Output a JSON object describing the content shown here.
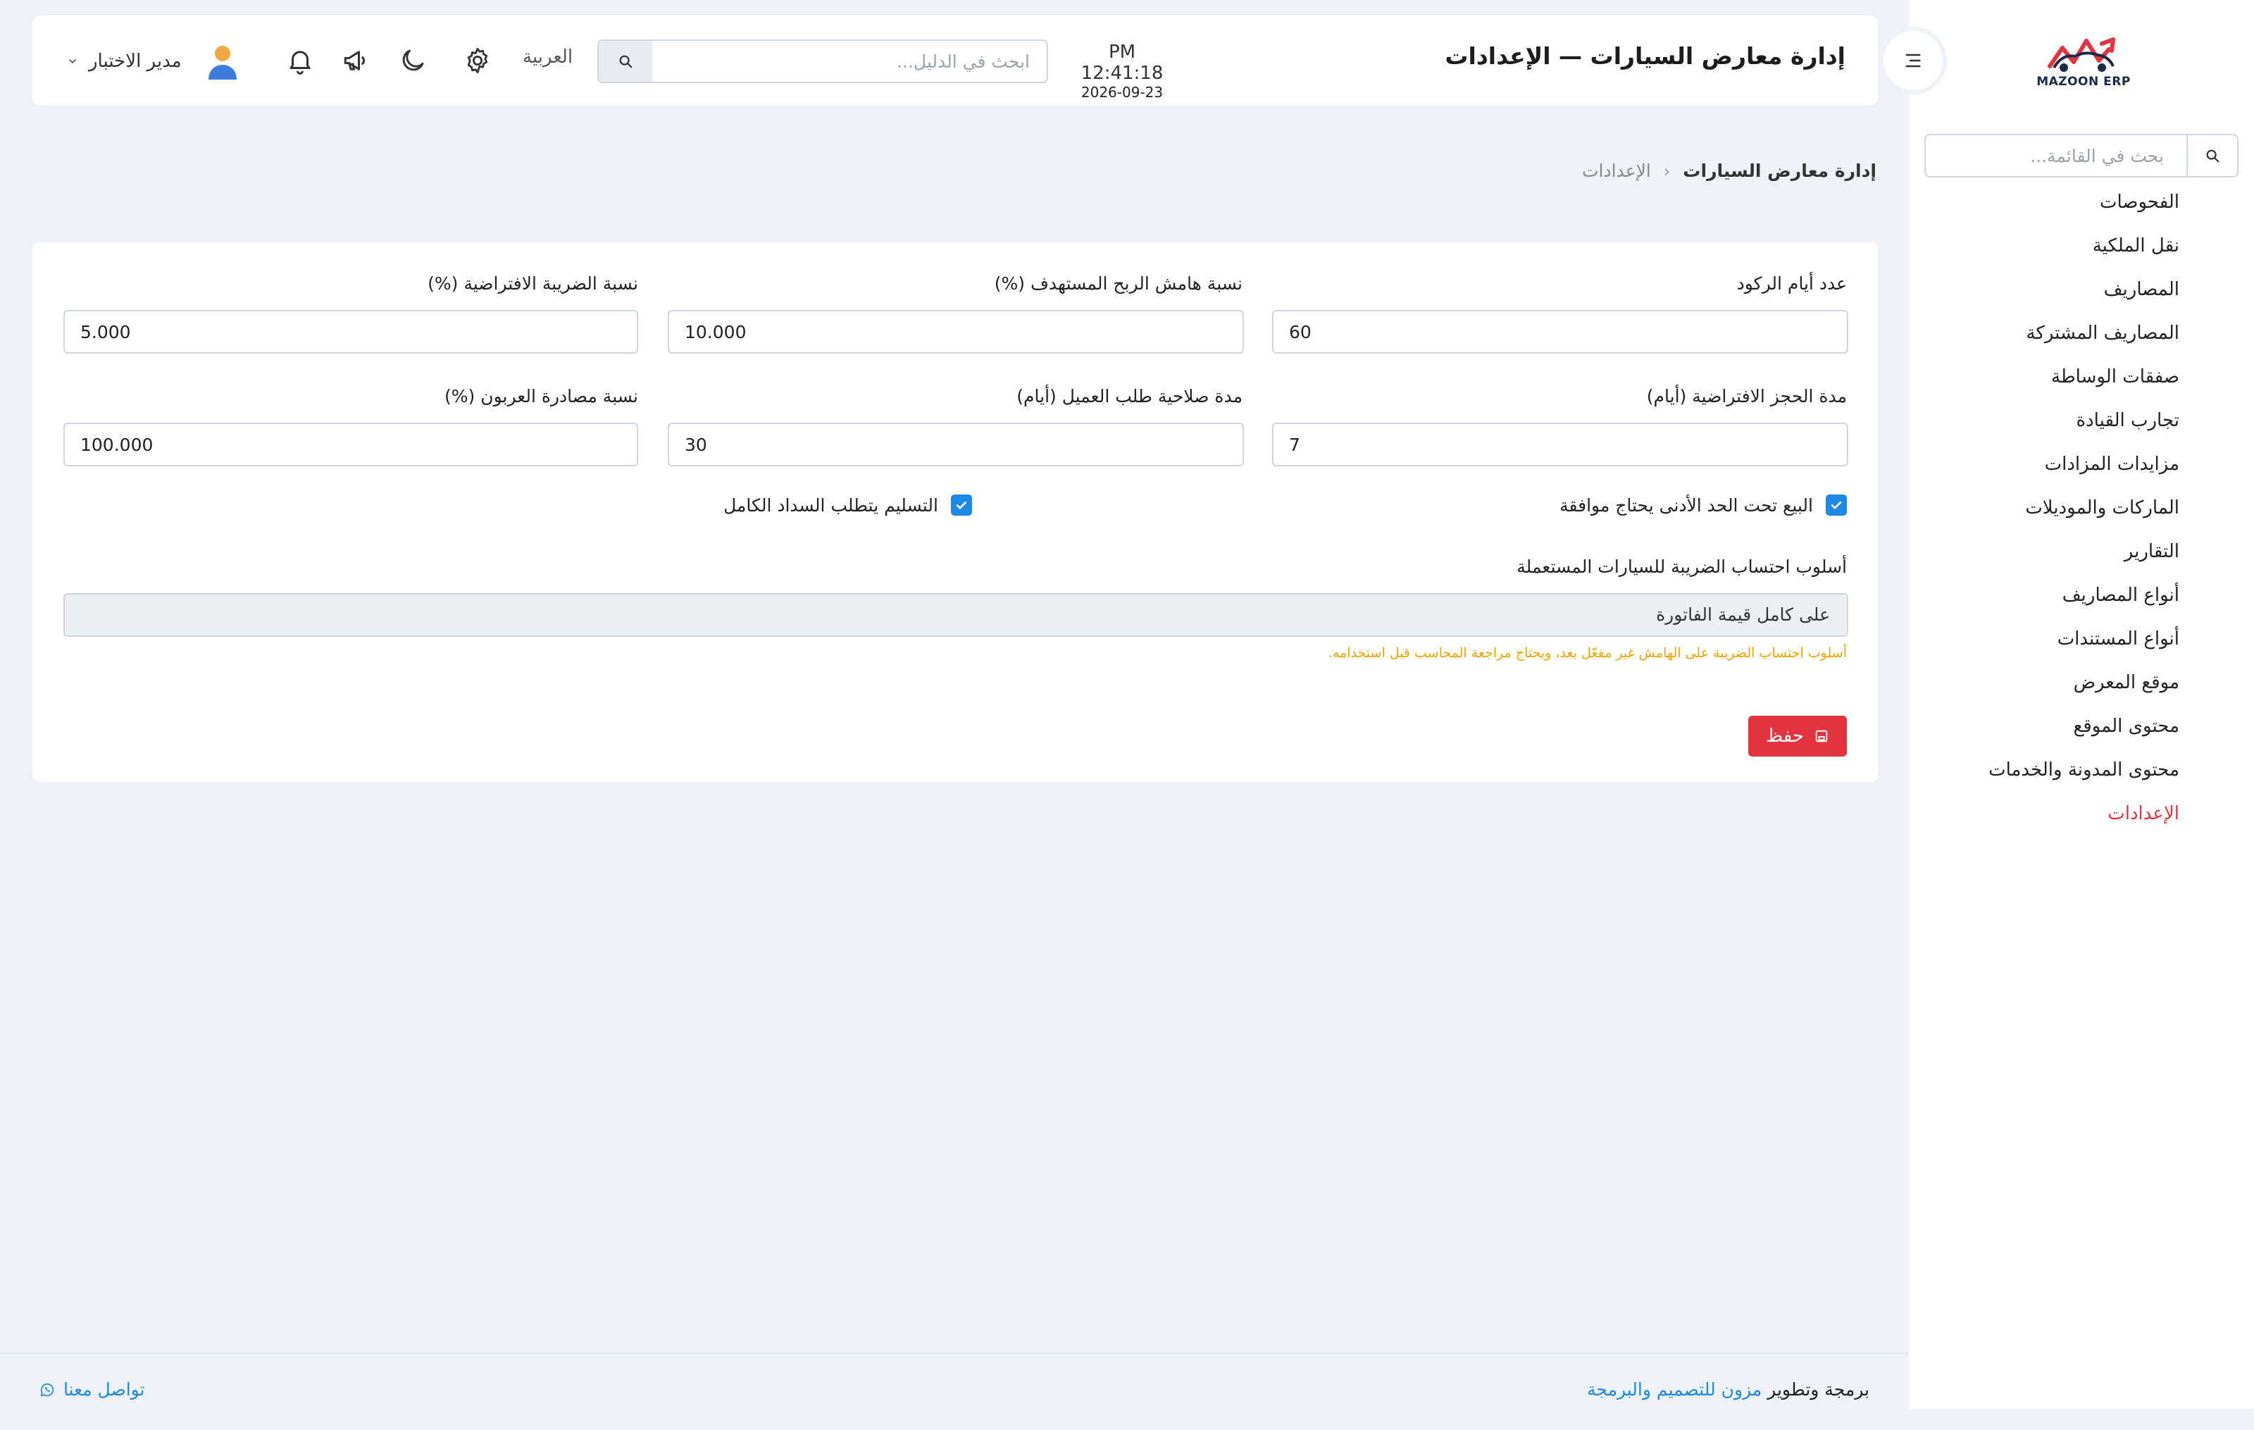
{
  "sidebar": {
    "logo_text": "MAZOON ERP",
    "search_placeholder": "بحث في القائمة...",
    "items": [
      {
        "label": "الفحوصات"
      },
      {
        "label": "نقل الملكية"
      },
      {
        "label": "المصاريف"
      },
      {
        "label": "المصاريف المشتركة"
      },
      {
        "label": "صفقات الوساطة"
      },
      {
        "label": "تجارب القيادة"
      },
      {
        "label": "مزايدات المزادات"
      },
      {
        "label": "الماركات والموديلات"
      },
      {
        "label": "التقارير"
      },
      {
        "label": "أنواع المصاريف"
      },
      {
        "label": "أنواع المستندات"
      },
      {
        "label": "موقع المعرض"
      },
      {
        "label": "محتوى الموقع"
      },
      {
        "label": "محتوى المدونة والخدمات"
      },
      {
        "label": "الإعدادات",
        "active": true
      }
    ]
  },
  "header": {
    "title": "إدارة معارض السيارات — الإعدادات",
    "time": "PM 12:41:18",
    "date": "2026-09-23",
    "search_placeholder": "ابحث في الدليل...",
    "language": "العربية",
    "user_name": "مدير الاختبار"
  },
  "breadcrumb": {
    "root": "إدارة معارض السيارات",
    "current": "الإعدادات"
  },
  "settings": {
    "stagnation_days": {
      "label": "عدد أيام الركود",
      "value": "60"
    },
    "target_margin": {
      "label": "نسبة هامش الربح المستهدف (%)",
      "value": "10.000"
    },
    "default_tax": {
      "label": "نسبة الضريبة الافتراضية (%)",
      "value": "5.000"
    },
    "reservation_days": {
      "label": "مدة الحجز الافتراضية (أيام)",
      "value": "7"
    },
    "request_validity": {
      "label": "مدة صلاحية طلب العميل (أيام)",
      "value": "30"
    },
    "deposit_forfeit": {
      "label": "نسبة مصادرة العربون (%)",
      "value": "100.000"
    },
    "below_min_check": {
      "label": "البيع تحت الحد الأدنى يحتاج موافقة",
      "checked": true
    },
    "full_payment_check": {
      "label": "التسليم يتطلب السداد الكامل",
      "checked": true
    },
    "used_tax_method": {
      "label": "أسلوب احتساب الضريبة للسيارات المستعملة",
      "value": "على كامل قيمة الفاتورة",
      "note": "أسلوب احتساب الضريبة على الهامش غير مفعّل بعد، ويحتاج مراجعة المحاسب قبل استخدامه."
    },
    "save_label": "حفظ"
  },
  "footer": {
    "credit_prefix": "برمجة وتطوير",
    "credit_link": "مزون للتصميم والبرمجة",
    "contact": "تواصل معنا"
  },
  "colors": {
    "accent": "#e3343f",
    "primary": "#1e88e5",
    "warning": "#f0a500",
    "background": "#eef2f6"
  }
}
